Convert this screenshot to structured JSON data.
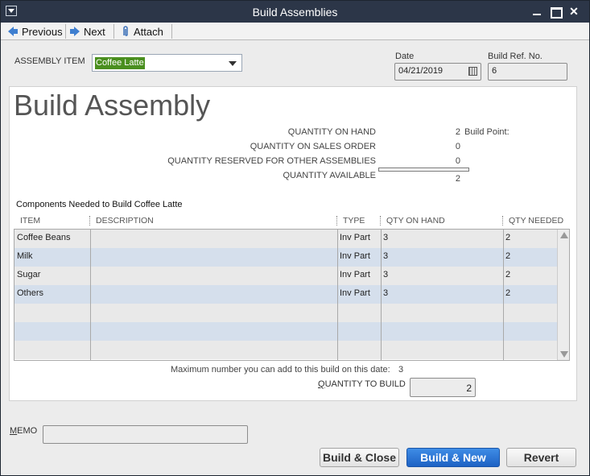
{
  "window": {
    "title": "Build Assemblies"
  },
  "toolbar": {
    "previous": "Previous",
    "next": "Next",
    "attach": "Attach"
  },
  "header": {
    "assembly_item_label": "ASSEMBLY ITEM",
    "assembly_item_value": "Coffee Latte",
    "date_label": "Date",
    "date_value": "04/21/2019",
    "ref_label": "Build Ref. No.",
    "ref_value": "6"
  },
  "main": {
    "title": "Build Assembly",
    "quantities": [
      {
        "label": "QUANTITY ON HAND",
        "value": "2"
      },
      {
        "label": "QUANTITY ON SALES ORDER",
        "value": "0"
      },
      {
        "label": "QUANTITY RESERVED FOR OTHER ASSEMBLIES",
        "value": "0"
      },
      {
        "label": "QUANTITY AVAILABLE",
        "value": "2"
      }
    ],
    "build_point": "Build Point:",
    "components_label": "Components Needed to Build  Coffee Latte"
  },
  "table": {
    "columns": [
      "ITEM",
      "DESCRIPTION",
      "TYPE",
      "QTY ON HAND",
      "QTY NEEDED"
    ],
    "rows": [
      {
        "item": "Coffee Beans",
        "description": "",
        "type": "Inv Part",
        "qty_on_hand": "3",
        "qty_needed": "2"
      },
      {
        "item": "Milk",
        "description": "",
        "type": "Inv Part",
        "qty_on_hand": "3",
        "qty_needed": "2"
      },
      {
        "item": "Sugar",
        "description": "",
        "type": "Inv Part",
        "qty_on_hand": "3",
        "qty_needed": "2"
      },
      {
        "item": "Others",
        "description": "",
        "type": "Inv Part",
        "qty_on_hand": "3",
        "qty_needed": "2"
      }
    ]
  },
  "footer": {
    "max_text": "Maximum number you can add to this build on this date:",
    "max_value": "3",
    "qty_to_build_label_first": "Q",
    "qty_to_build_label_rest": "UANTITY TO BUILD",
    "qty_to_build_value": "2",
    "memo_label_first": "M",
    "memo_label_rest": "EMO",
    "memo_value": ""
  },
  "buttons": {
    "build_close": "Build & Close",
    "build_new": "Build & New",
    "revert": "Revert"
  },
  "colors": {
    "accent": "#1e62c4",
    "titlebar": "#2c3648",
    "selection": "#4a8f1f",
    "row_alt": "#d5dfec"
  }
}
